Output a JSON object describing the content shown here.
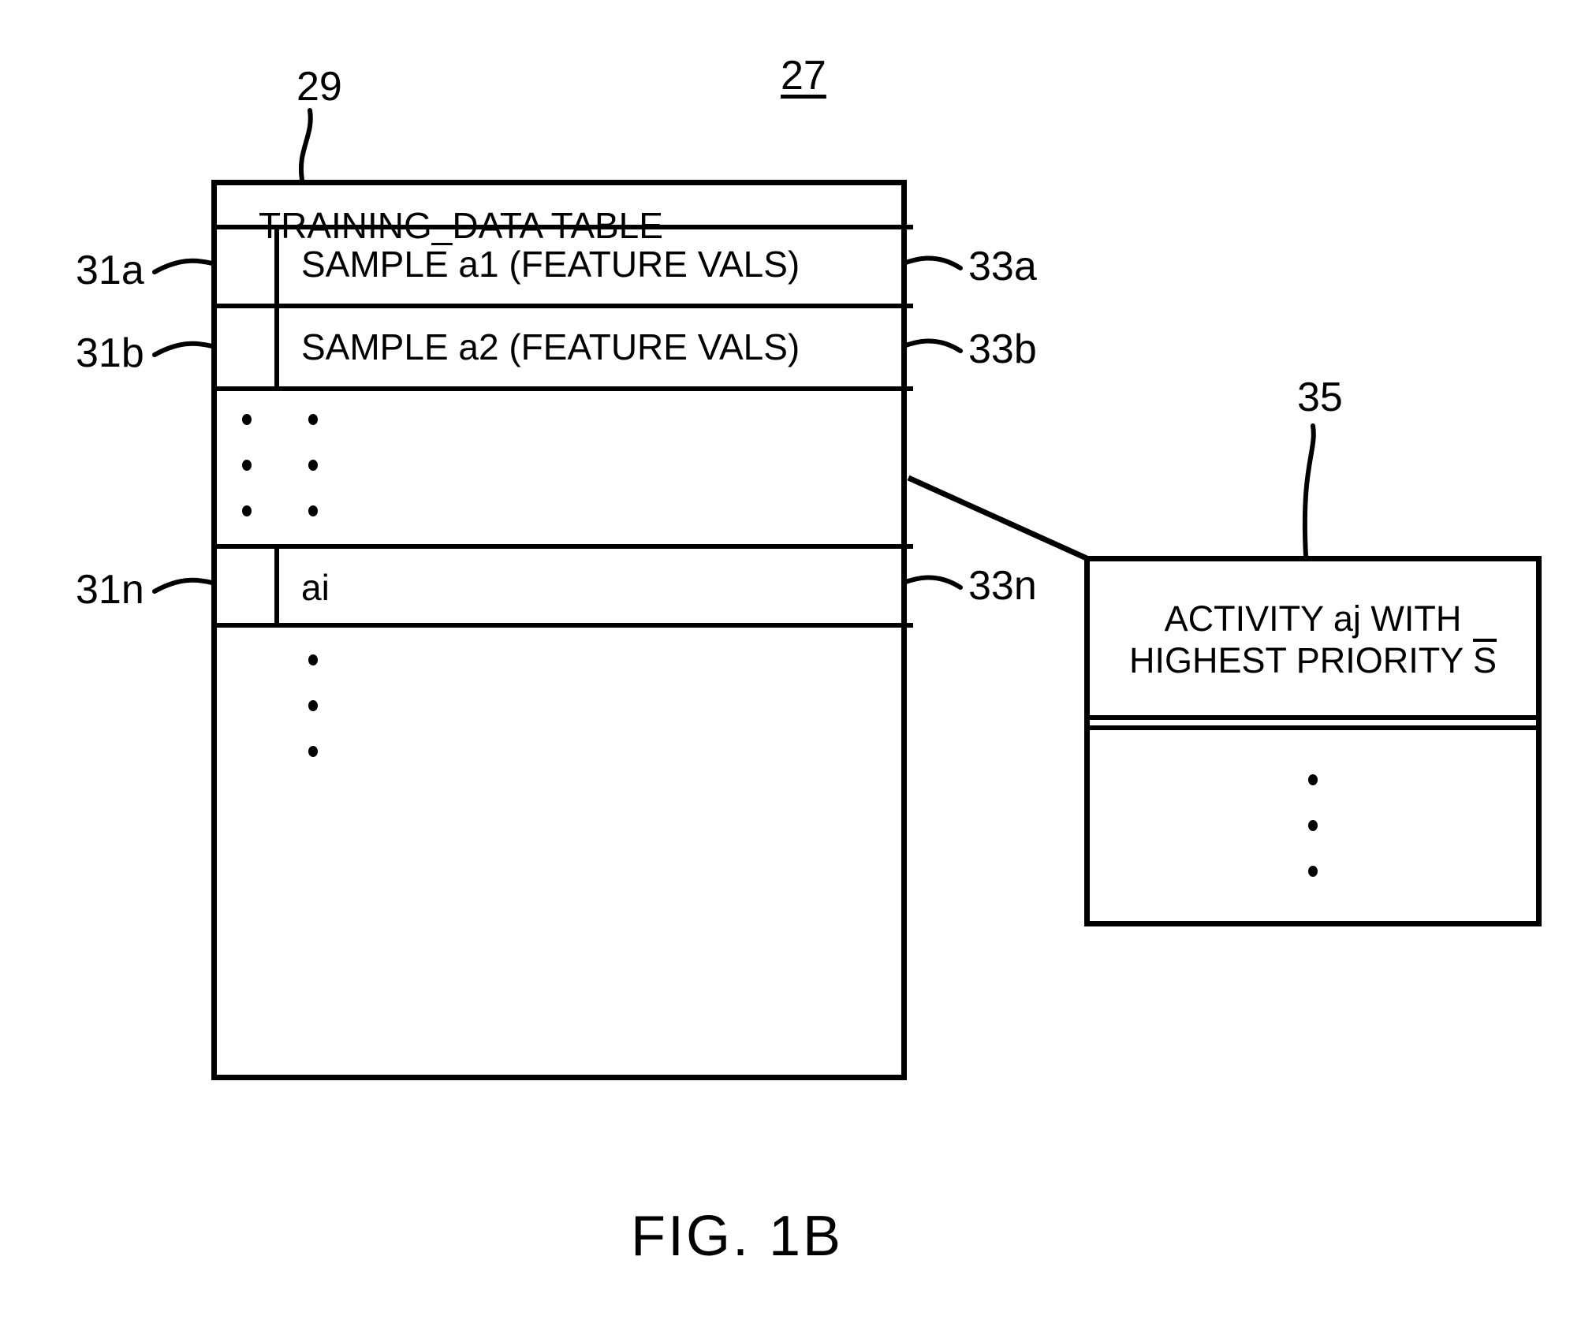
{
  "figure": {
    "caption": "FIG. 1B",
    "diagram_ref": "27",
    "table_ref": "29",
    "activity_box_ref": "35"
  },
  "table": {
    "title": "TRAINING_DATA TABLE",
    "rows": [
      {
        "left_ref": "31a",
        "right_ref": "33a",
        "label": "SAMPLE a1 (FEATURE VALS)"
      },
      {
        "left_ref": "31b",
        "right_ref": "33b",
        "label": "SAMPLE a2 (FEATURE VALS)"
      },
      {
        "left_ref": "31n",
        "right_ref": "33n",
        "label": "ai"
      }
    ],
    "ellipsis_glyph": "vertical-ellipsis"
  },
  "activity_box": {
    "line1": "ACTIVITY aj WITH",
    "line2_prefix": "HIGHEST PRIORITY ",
    "line2_symbol": "S",
    "line2_symbol_note": "S with overline",
    "ellipsis_glyph": "vertical-ellipsis"
  },
  "colors": {
    "ink": "#000000",
    "background": "#ffffff"
  }
}
